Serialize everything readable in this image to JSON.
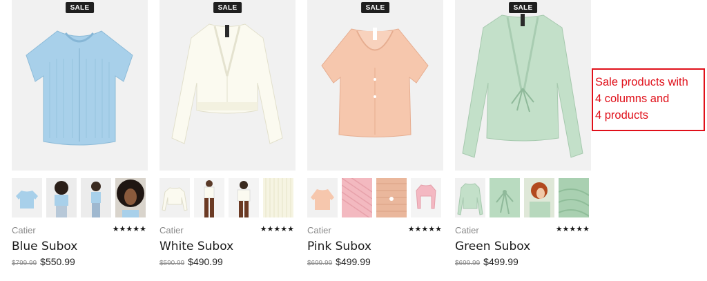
{
  "products": [
    {
      "badge": "SALE",
      "brand": "Catier",
      "rating_text": "★★★★★",
      "name": "Blue Subox",
      "old_price": "$799.99",
      "new_price": "$550.99",
      "color": "#a8cfe8"
    },
    {
      "badge": "SALE",
      "brand": "Catier",
      "rating_text": "★★★★★",
      "name": "White Subox",
      "old_price": "$590.99",
      "new_price": "$490.99",
      "color": "#f5f3e0"
    },
    {
      "badge": "SALE",
      "brand": "Catier",
      "rating_text": "★★★★★",
      "name": "Pink Subox",
      "old_price": "$699.99",
      "new_price": "$499.99",
      "color": "#f2c2a8"
    },
    {
      "badge": "SALE",
      "brand": "Catier",
      "rating_text": "★★★★★",
      "name": "Green Subox",
      "old_price": "$699.99",
      "new_price": "$499.99",
      "color": "#bfdcc4"
    }
  ],
  "annotation": {
    "line1": "Sale products with",
    "line2": "4 columns and",
    "line3": "4 products"
  }
}
